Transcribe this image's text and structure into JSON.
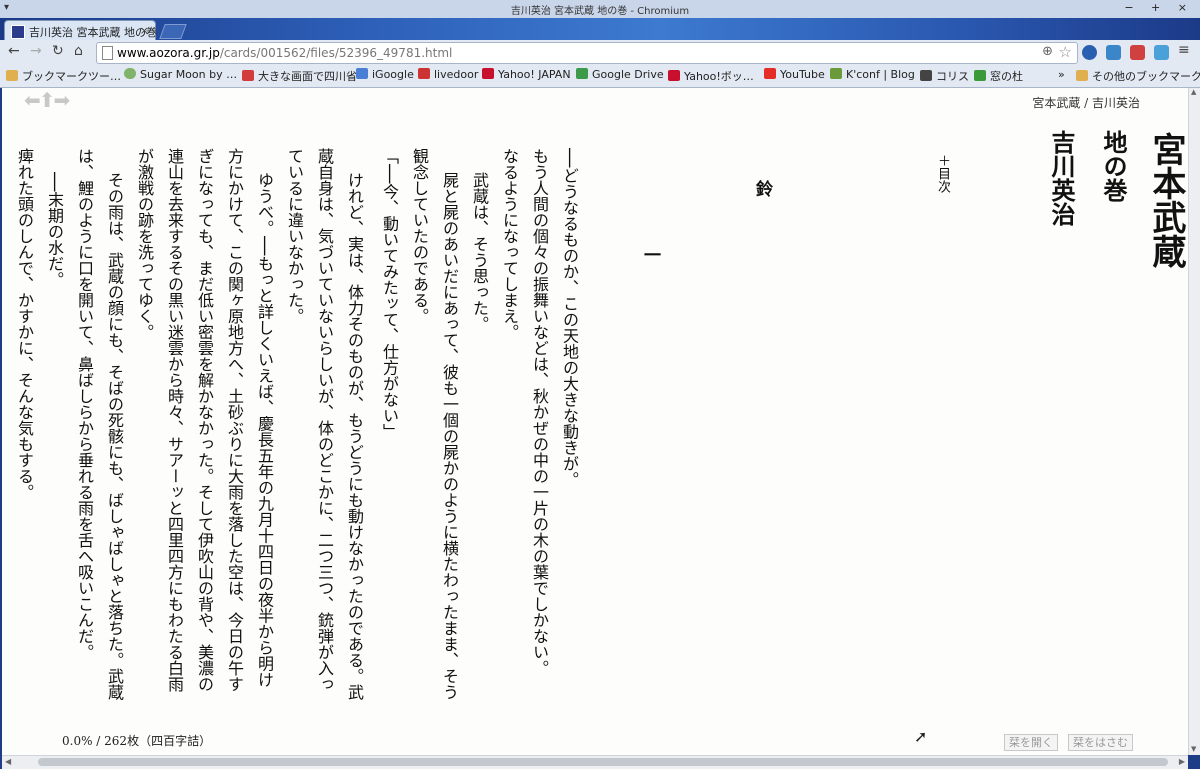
{
  "window": {
    "title": "吉川英治 宮本武蔵 地の巻 - Chromium",
    "controls": "− + ×"
  },
  "tab": {
    "label": "吉川英治 宮本武蔵 地の巻",
    "close": "×"
  },
  "toolbar": {
    "back": "←",
    "forward": "→",
    "reload": "↻",
    "home": "⌂",
    "url_host": "www.aozora.gr.jp",
    "url_rest": "/cards/001562/files/52396_49781.html",
    "zoom": "⊕",
    "star": "☆",
    "menu": "≡"
  },
  "bookmarks": {
    "items": [
      {
        "label": "ブックマークツー…",
        "color": "#e0b050"
      },
      {
        "label": "Sugar Moon by …",
        "color": "#7fb46a"
      },
      {
        "label": "大きな画面で四川省",
        "color": "#d23c3c"
      },
      {
        "label": "iGoogle",
        "color": "#4a7fd6"
      },
      {
        "label": "livedoor",
        "color": "#cc3333"
      },
      {
        "label": "Yahoo! JAPAN",
        "color": "#c8102e"
      },
      {
        "label": "Google Drive",
        "color": "#3c9a4a"
      },
      {
        "label": "Yahoo!ボッ…",
        "color": "#c8102e"
      },
      {
        "label": "YouTube",
        "color": "#e52d27"
      },
      {
        "label": "K'conf | Blog",
        "color": "#6a9a3a"
      },
      {
        "label": "コリス",
        "color": "#444444"
      },
      {
        "label": "窓の杜",
        "color": "#3a9a3a"
      }
    ],
    "overflow": "»",
    "other": "その他のブックマーク"
  },
  "page": {
    "byline": "宮本武蔵 / 吉川英治",
    "title": "宮本武蔵",
    "subtitle": "地の巻",
    "author": "吉川英治",
    "toc": "＋目次",
    "chapter": "鈴",
    "section": "一",
    "lines": [
      "──どうなるものか、この天地の大きな動きが。",
      "もう人間の個々の振舞いなどは、秋かぜの中の一片の木の葉でしかない。",
      "なるようになってしまえ。",
      "武蔵は、そう思った。",
      "屍と屍のあいだにあって、彼も一個の屍かのように横たわったまま、そう",
      "観念していたのである。",
      "「──今、動いてみたッて、仕方がない」",
      "けれど、実は、体力そのものが、もうどうにも動けなかったのである。武",
      "蔵自身は、気づいていないらしいが、体のどこかに、二つ三つ、銃弾が入っ",
      "ているに違いなかった。",
      "ゆうべ。──もっと詳しくいえば、慶長五年の九月十四日の夜半から明け",
      "方にかけて、この関ヶ原地方へ、土砂ぶりに大雨を落した空は、今日の午す",
      "ぎになっても、まだ低い密雲を解かなかった。そして伊吹山の背や、美濃の",
      "連山を去来するその黒い迷雲から時々、サアーッと四里四方にもわたる白雨",
      "が激戦の跡を洗ってゆく。",
      "その雨は、武蔵の顔にも、そばの死骸にも、ばしゃばしゃと落ちた。武蔵",
      "は、鯉のように口を開いて、鼻ばしらから垂れる雨を舌へ吸いこんだ。",
      "──末期の水だ。",
      "痺れた頭のしんで、かすかに、そんな気もする。"
    ],
    "status": "0.0% / 262枚（四百字詰）",
    "btn_open": "栞を開く",
    "btn_insert": "栞をはさむ"
  }
}
